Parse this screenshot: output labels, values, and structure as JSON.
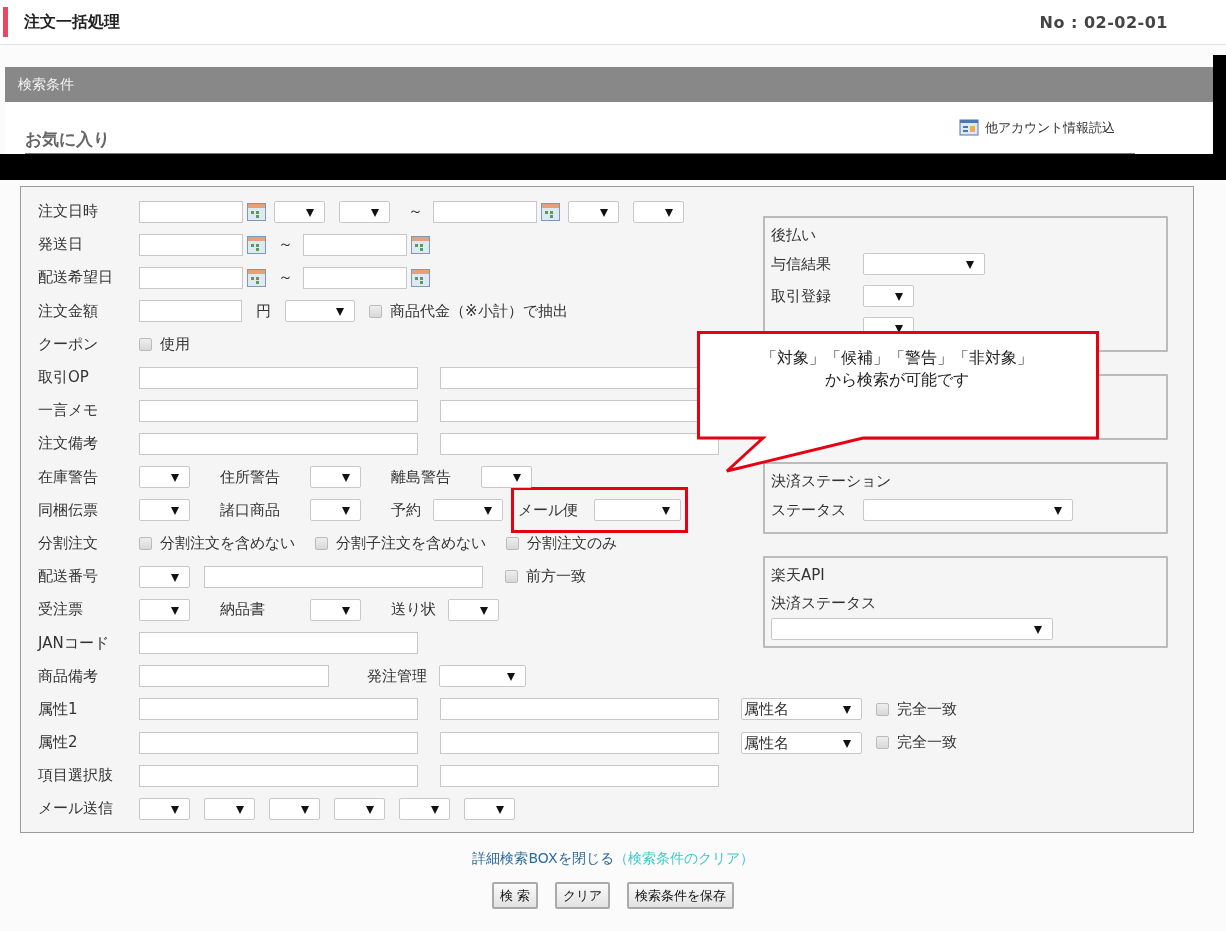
{
  "header": {
    "title": "注文一括処理",
    "screen_no": "No : 02-02-01"
  },
  "search_panel": {
    "title": "検索条件",
    "favorites_label": "お気に入り",
    "load_link": "他アカウント情報読込"
  },
  "form_rows": [
    {
      "label": "注文日時",
      "items": [
        {
          "kind": "date"
        },
        {
          "kind": "select"
        },
        {
          "kind": "select"
        },
        {
          "kind": "separator",
          "text": "～"
        },
        {
          "kind": "date"
        },
        {
          "kind": "select"
        },
        {
          "kind": "select"
        }
      ]
    },
    {
      "label": "発送日",
      "items": [
        {
          "kind": "date"
        },
        {
          "kind": "separator",
          "text": "～"
        },
        {
          "kind": "date"
        }
      ]
    },
    {
      "label": "配送希望日",
      "items": [
        {
          "kind": "date"
        },
        {
          "kind": "separator",
          "text": "～"
        },
        {
          "kind": "date"
        }
      ]
    },
    {
      "label": "注文金額",
      "items": [
        {
          "kind": "input_short"
        },
        {
          "kind": "unit",
          "text": "円"
        },
        {
          "kind": "select_medium"
        },
        {
          "kind": "checkbox",
          "text": "商品代金（※小計）で抽出",
          "checked": false
        }
      ]
    },
    {
      "label": "クーポン",
      "items": [
        {
          "kind": "checkbox",
          "text": "使用",
          "checked": false
        }
      ]
    },
    {
      "label": "取引OP",
      "items": [
        {
          "kind": "input"
        },
        {
          "kind": "input"
        }
      ]
    },
    {
      "label": "一言メモ",
      "items": [
        {
          "kind": "input"
        },
        {
          "kind": "input"
        }
      ]
    },
    {
      "label": "注文備考",
      "items": [
        {
          "kind": "input"
        },
        {
          "kind": "input"
        }
      ]
    },
    {
      "label": "在庫警告",
      "items": [
        {
          "kind": "select"
        },
        {
          "kind": "sublabel",
          "text": "住所警告"
        },
        {
          "kind": "select"
        },
        {
          "kind": "sublabel",
          "text": "離島警告"
        },
        {
          "kind": "select"
        }
      ]
    },
    {
      "label": "同梱伝票",
      "items": [
        {
          "kind": "select"
        },
        {
          "kind": "sublabel",
          "text": "諸口商品"
        },
        {
          "kind": "select"
        },
        {
          "kind": "sublabel_short",
          "text": "予約"
        },
        {
          "kind": "select_medium"
        },
        {
          "kind": "highlight",
          "items": [
            {
              "kind": "sublabel_short",
              "text": "メール便"
            },
            {
              "kind": "select_wide"
            }
          ]
        }
      ]
    },
    {
      "label": "分割注文",
      "items": [
        {
          "kind": "checkbox",
          "text": "分割注文を含めない",
          "checked": false
        },
        {
          "kind": "checkbox",
          "text": "分割子注文を含めない",
          "checked": false
        },
        {
          "kind": "checkbox",
          "text": "分割注文のみ",
          "checked": false
        }
      ]
    },
    {
      "label": "配送番号",
      "items": [
        {
          "kind": "select"
        },
        {
          "kind": "input"
        },
        {
          "kind": "checkbox",
          "text": "前方一致",
          "checked": false
        }
      ]
    },
    {
      "label": "受注票",
      "items": [
        {
          "kind": "select"
        },
        {
          "kind": "sublabel",
          "text": "納品書"
        },
        {
          "kind": "select"
        },
        {
          "kind": "sublabel_short",
          "text": "送り状"
        },
        {
          "kind": "select"
        }
      ]
    },
    {
      "label": "JANコード",
      "items": [
        {
          "kind": "input"
        }
      ]
    },
    {
      "label": "商品備考",
      "items": [
        {
          "kind": "input_medium"
        },
        {
          "kind": "sublabel_short",
          "text": "発注管理"
        },
        {
          "kind": "select_wide"
        }
      ]
    },
    {
      "label": "属性1",
      "items": [
        {
          "kind": "input"
        },
        {
          "kind": "input"
        },
        {
          "kind": "select_value",
          "value": "属性名"
        },
        {
          "kind": "checkbox",
          "text": "完全一致",
          "checked": false
        }
      ]
    },
    {
      "label": "属性2",
      "items": [
        {
          "kind": "input"
        },
        {
          "kind": "input"
        },
        {
          "kind": "select_value",
          "value": "属性名"
        },
        {
          "kind": "checkbox",
          "text": "完全一致",
          "checked": false
        }
      ]
    },
    {
      "label": "項目選択肢",
      "items": [
        {
          "kind": "input"
        },
        {
          "kind": "input"
        }
      ]
    },
    {
      "label": "メール送信",
      "items": [
        {
          "kind": "select"
        },
        {
          "kind": "select"
        },
        {
          "kind": "select"
        },
        {
          "kind": "select"
        },
        {
          "kind": "select"
        },
        {
          "kind": "select"
        }
      ]
    }
  ],
  "side_boxes": [
    {
      "title": "後払い",
      "rows": [
        {
          "kind": "inline",
          "label": "与信結果",
          "items": [
            {
              "kind": "select_value_wide"
            }
          ]
        },
        {
          "kind": "inline",
          "label": "取引登録",
          "items": [
            {
              "kind": "select"
            }
          ]
        },
        {
          "kind": "inline",
          "items": [
            {
              "kind": "select"
            }
          ]
        }
      ]
    },
    {
      "title": "決済ステーション",
      "rows": [
        {
          "kind": "inline",
          "label": "ステータス",
          "items": [
            {
              "kind": "select_xwide"
            }
          ]
        }
      ]
    },
    {
      "title": "楽天API",
      "rows": [
        {
          "kind": "stacked",
          "label": "決済ステータス",
          "items": [
            {
              "kind": "select_full"
            }
          ]
        }
      ]
    }
  ],
  "callout": {
    "lines": [
      "「対象」「候補」「警告」「非対象」",
      "から検索が可能です"
    ]
  },
  "footer": {
    "close_link": "詳細検索BOXを閉じる",
    "clear_link": "（検索条件のクリア）",
    "buttons": [
      "検 索",
      "クリア",
      "検索条件を保存"
    ]
  }
}
